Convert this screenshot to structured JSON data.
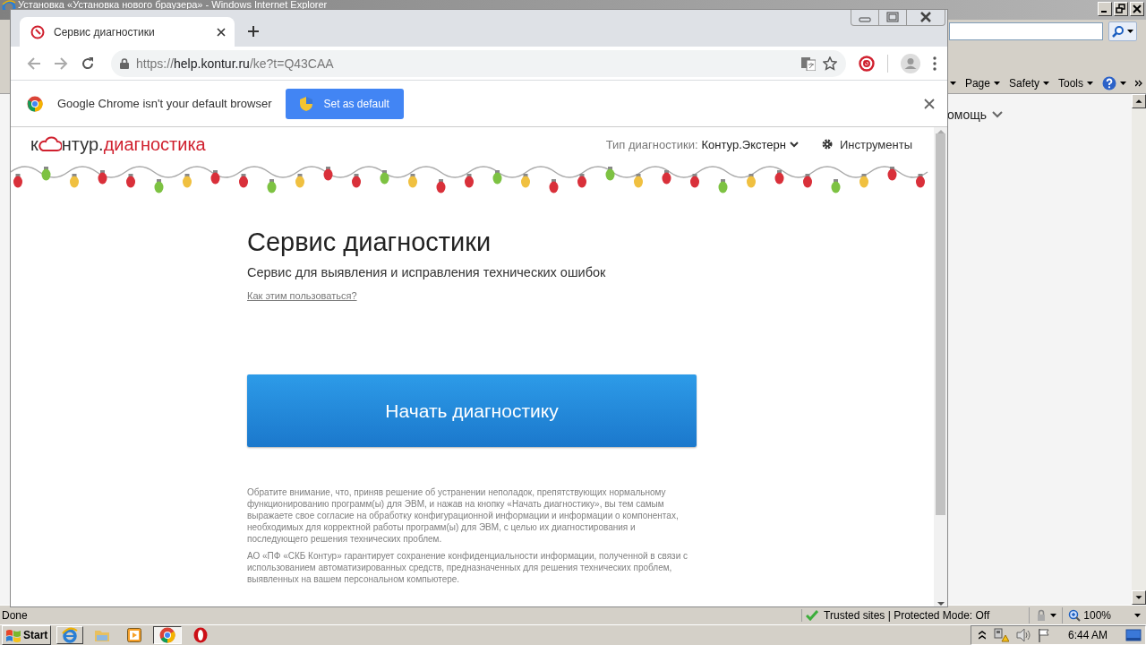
{
  "ie_window": {
    "title": "Установка «Установка нового браузера» - Windows Internet Explorer",
    "toolbar": [
      "Page",
      "Safety",
      "Tools"
    ],
    "content_menu": "омощь",
    "status": "Done",
    "zone": "Trusted sites | Protected Mode: Off",
    "zoom": "100%"
  },
  "chrome": {
    "tabs": [
      {
        "title": "Сервис диагностики",
        "selected": true
      }
    ],
    "address": {
      "scheme": "https://",
      "host": "help.kontur.ru",
      "path": "/ke?t=Q43CAA"
    },
    "infobar": {
      "message": "Google Chrome isn't your default browser",
      "button": "Set as default"
    }
  },
  "page": {
    "logo": {
      "prefix": "к",
      "rest": "нтур.",
      "product": "диагностика"
    },
    "diagnostic_type": {
      "label": "Тип диагностики:",
      "value": "Контур.Экстерн"
    },
    "tools": "Инструменты",
    "title": "Сервис диагностики",
    "subtitle": "Сервис для выявления и исправления технических ошибок",
    "help_link": "Как этим пользоваться?",
    "start_button": "Начать диагностику",
    "notices": [
      "Обратите внимание, что, приняв решение об устранении неполадок, препятствующих нормальному функционированию программ(ы) для ЭВМ, и нажав на кнопку «Начать диагностику», вы тем самым выражаете свое согласие на обработку конфигурационной информации и информации о компонентах, необходимых для корректной работы программ(ы) для ЭВМ, с целью их диагностирования и последующего решения технических проблем.",
      "АО «ПФ «СКБ Контур» гарантирует сохранение конфиденциальности информации, полученной в связи с использованием автоматизированных средств, предназначенных для решения технических проблем, выявленных на вашем персональном компьютере."
    ]
  },
  "taskbar": {
    "start": "Start",
    "clock": "6:44 AM",
    "apps": [
      {
        "kind": "ie",
        "selected": false
      },
      {
        "kind": "folder",
        "selected": false
      },
      {
        "kind": "media",
        "selected": false
      },
      {
        "kind": "chrome",
        "selected": true
      },
      {
        "kind": "opera",
        "selected": false
      }
    ]
  }
}
